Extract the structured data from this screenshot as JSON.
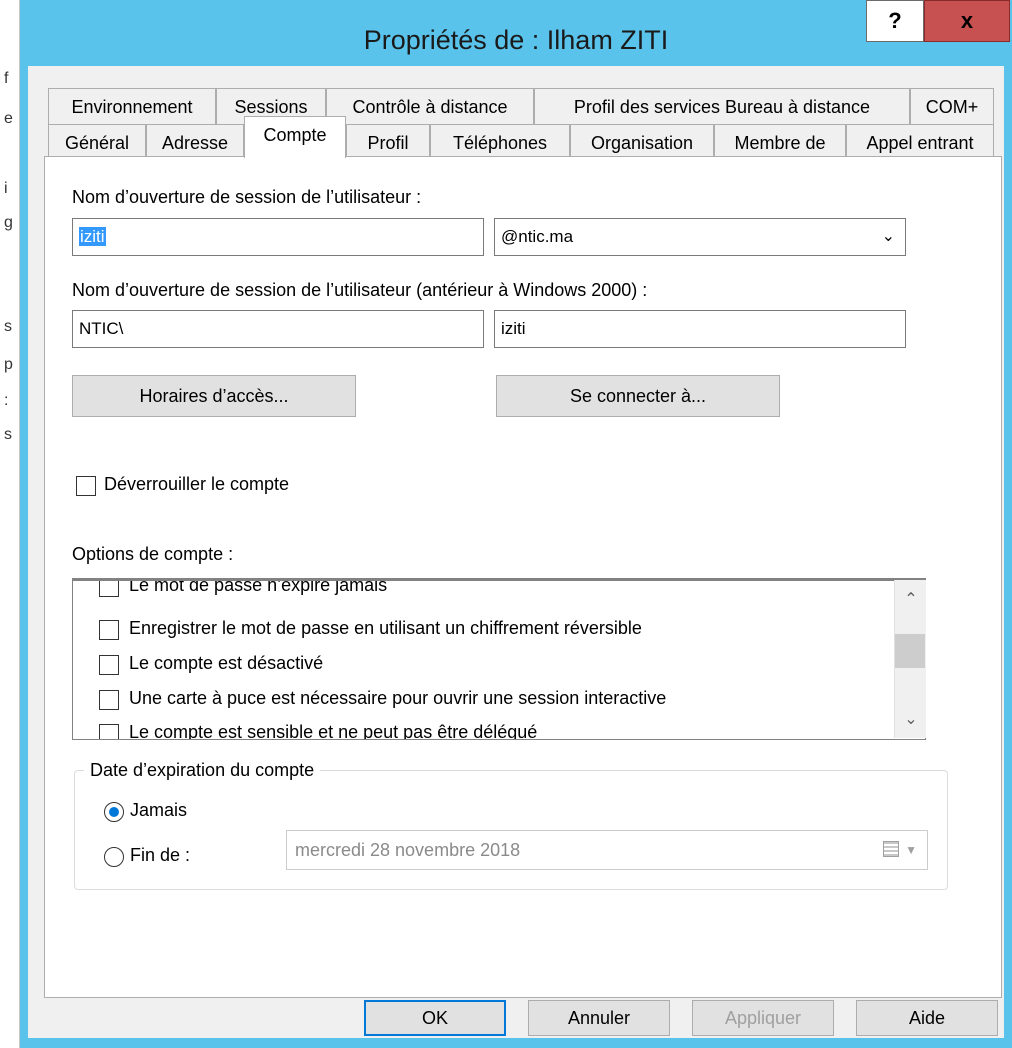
{
  "dialog": {
    "title": "Propriétés de : Ilham ZITI",
    "help_label": "?",
    "close_label": "x"
  },
  "background_chars": [
    "f",
    "e",
    "i",
    "g",
    "s",
    "p",
    ":",
    "s"
  ],
  "tabs_row1": [
    "Environnement",
    "Sessions",
    "Contrôle à distance",
    "Profil des services Bureau à distance",
    "COM+"
  ],
  "tabs_row2": [
    "Général",
    "Adresse",
    "Compte",
    "Profil",
    "Téléphones",
    "Organisation",
    "Membre de",
    "Appel entrant"
  ],
  "active_tab": "Compte",
  "logon": {
    "label": "Nom d’ouverture de session de l’utilisateur :",
    "value": "iziti",
    "domain": "@ntic.ma"
  },
  "logon_pre2000": {
    "label": "Nom d’ouverture de session de l’utilisateur (antérieur à Windows 2000) :",
    "prefix": "NTIC\\",
    "value": "iziti"
  },
  "buttons": {
    "logon_hours": "Horaires d’accès...",
    "log_on_to": "Se connecter à...",
    "ok": "OK",
    "cancel": "Annuler",
    "apply": "Appliquer",
    "help": "Aide"
  },
  "unlock_label": "Déverrouiller le compte",
  "account_options": {
    "label": "Options de compte :",
    "items": [
      "Le mot de passe n’expire jamais",
      "Enregistrer le mot de passe en utilisant un chiffrement réversible",
      "Le compte est désactivé",
      "Une carte à puce est nécessaire pour ouvrir une session interactive",
      "Le compte est sensible et ne peut pas être délégué"
    ]
  },
  "expiration": {
    "legend": "Date d’expiration du compte",
    "never_label": "Jamais",
    "end_label": "Fin de :",
    "date_value": "mercredi  28 novembre 2018"
  }
}
